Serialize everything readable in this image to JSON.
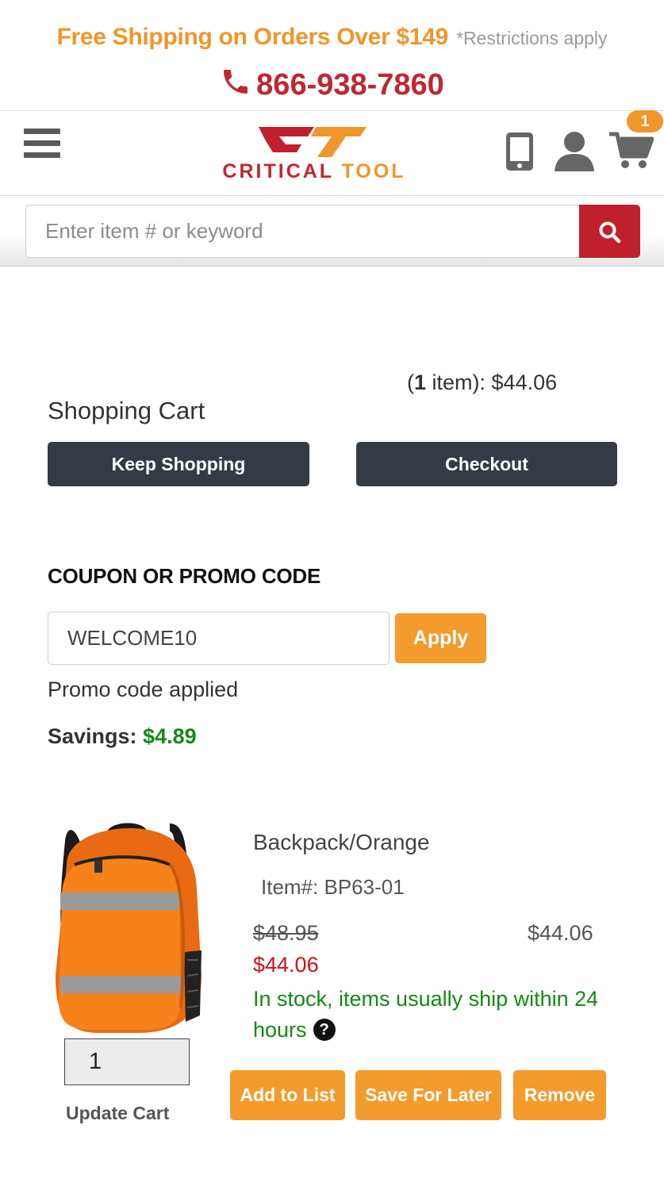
{
  "banner": {
    "shipping_text": "Free Shipping on Orders Over $149",
    "restrictions_text": "*Restrictions apply",
    "phone": "866-938-7860"
  },
  "header": {
    "logo_word1": "CRITICAL",
    "logo_word2": "TOOL",
    "cart_count": "1"
  },
  "search": {
    "placeholder": "Enter item # or keyword"
  },
  "cart": {
    "summary_open": "(",
    "summary_count": "1",
    "summary_rest": " item): $44.06",
    "title": "Shopping Cart",
    "keep_shopping_label": "Keep Shopping",
    "checkout_label": "Checkout"
  },
  "coupon": {
    "heading": "COUPON OR PROMO CODE",
    "value": "WELCOME10",
    "apply_label": "Apply",
    "status": "Promo code applied",
    "savings_label": "Savings: ",
    "savings_amount": "$4.89"
  },
  "product": {
    "name": "Backpack/Orange",
    "item_number": "Item#: BP63-01",
    "list_price": "$48.95",
    "line_total": "$44.06",
    "sale_price": "$44.06",
    "stock_text": "In stock, items usually ship within 24 hours",
    "help_glyph": "?",
    "quantity": "1",
    "update_label": "Update Cart",
    "add_to_list_label": "Add to List",
    "save_for_later_label": "Save For Later",
    "remove_label": "Remove"
  },
  "colors": {
    "brand_red": "#c0202e",
    "brand_orange": "#f39b2c",
    "dark_button": "#343b44",
    "in_stock_green": "#138a13",
    "sale_red": "#d0101a"
  },
  "icons": [
    "phone-icon",
    "menu-icon",
    "device-icon",
    "user-icon",
    "cart-icon",
    "search-icon",
    "help-icon"
  ]
}
